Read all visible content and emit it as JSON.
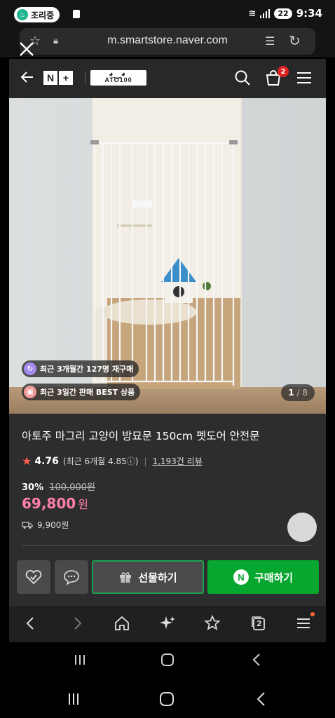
{
  "status_bar": {
    "notification_label": "조리중",
    "battery_percent": "22",
    "time": "9:34"
  },
  "browser": {
    "url": "m.smartstore.naver.com",
    "tabs_count": "2"
  },
  "shop_header": {
    "nplus_left": "N",
    "nplus_right": "+",
    "brand_logo_text": "ATO100",
    "cart_count": "2"
  },
  "product": {
    "badges": [
      {
        "text": "최근 3개월간 127명 재구매",
        "icon_color": "#a58bf0",
        "icon": "refresh-icon"
      },
      {
        "text": "최근 3일간 판매 BEST 상품",
        "icon_color": "#f29a9a",
        "icon": "gift-box-icon"
      }
    ],
    "image_index": "1",
    "image_total": "/ 8",
    "title": "아토주 마그리 고양이 방묘문 150cm 펫도어 안전문",
    "rating": "4.76",
    "rating_detail": "(최근 6개월 4.85ⓘ)",
    "review_count": "1,193건 리뷰",
    "discount_percent": "30%",
    "original_price": "100,000원",
    "price": "69,800",
    "price_unit": "원",
    "shipping_fee": "9,900원"
  },
  "actions": {
    "gift_label": "선물하기",
    "buy_label": "구매하기",
    "buy_logo": "N"
  },
  "colors": {
    "buy_green": "#07a62f",
    "price_pink": "#ff7fa8",
    "star_orange": "#ff5e4d",
    "badge_red": "#e02020"
  }
}
